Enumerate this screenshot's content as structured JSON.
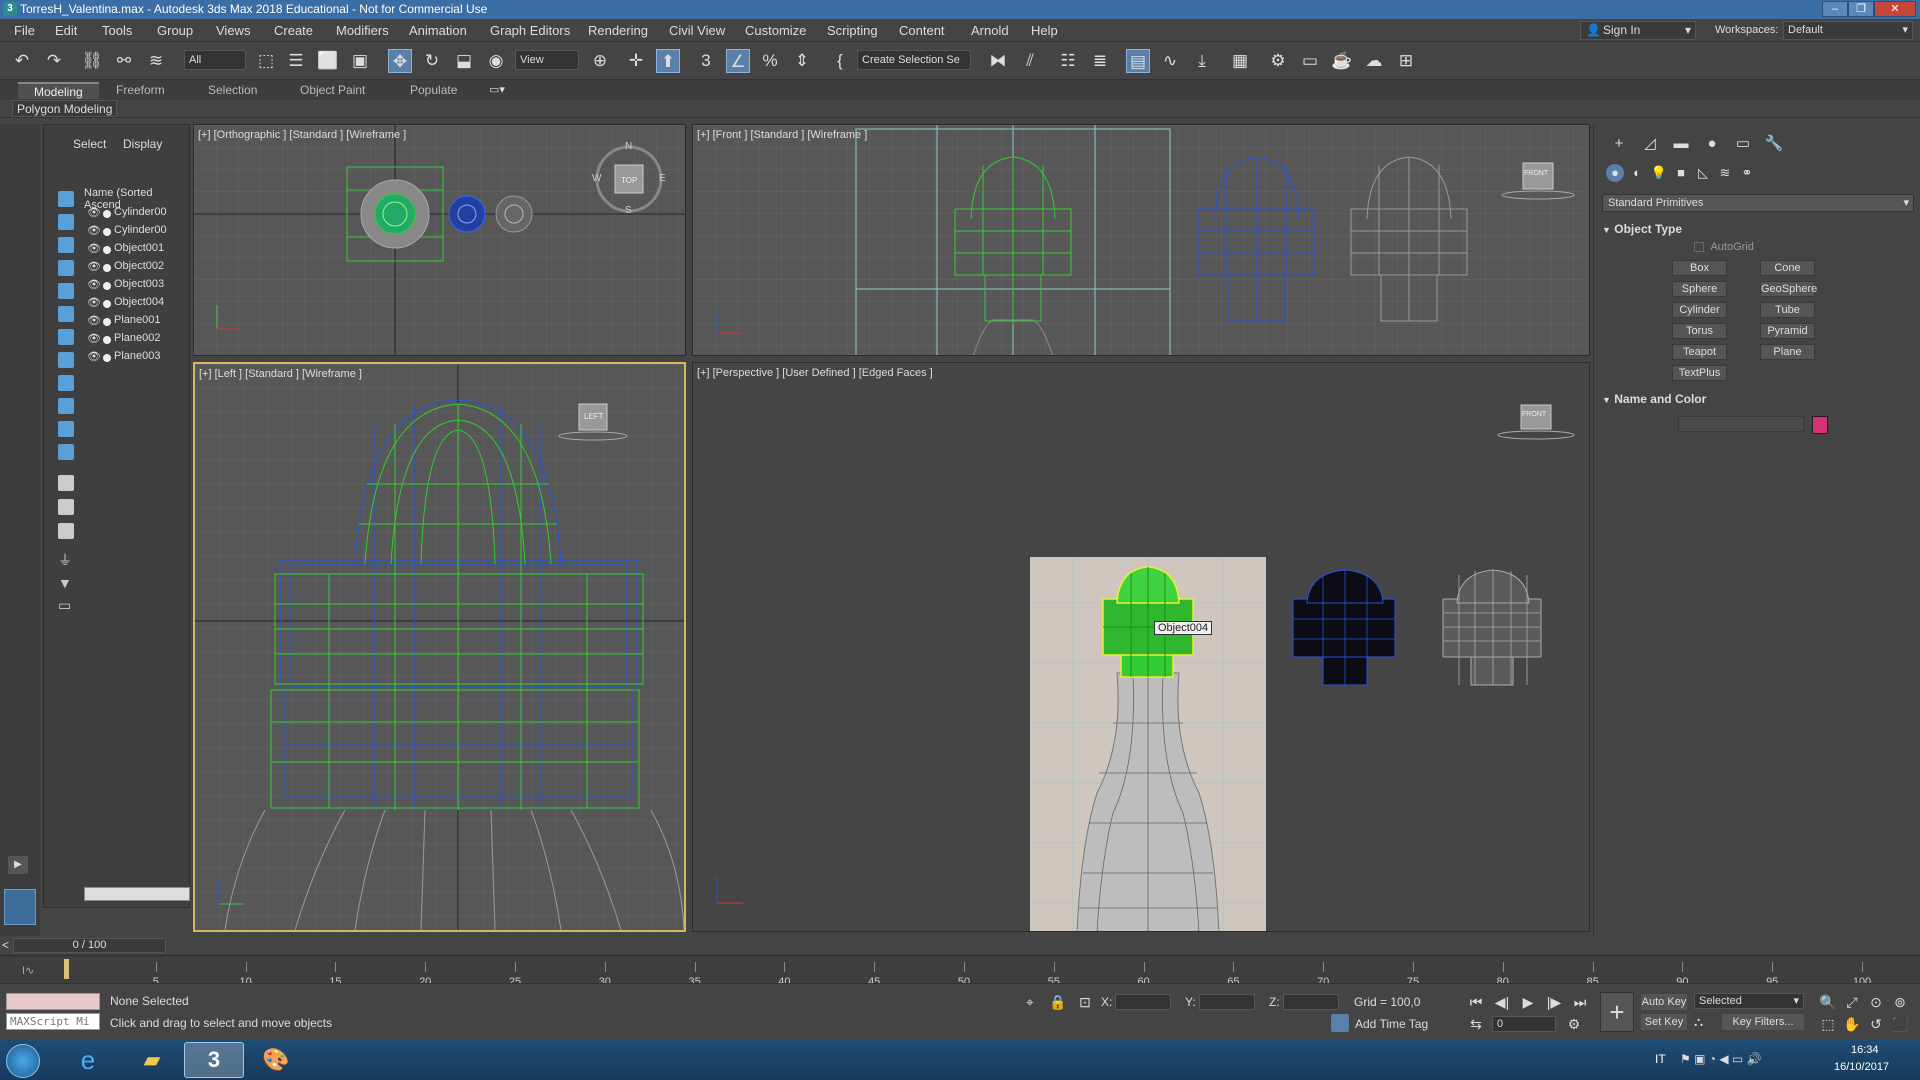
{
  "window": {
    "title": "TorresH_Valentina.max - Autodesk 3ds Max 2018 Educational - Not for Commercial Use"
  },
  "menu": [
    "File",
    "Edit",
    "Tools",
    "Group",
    "Views",
    "Create",
    "Modifiers",
    "Animation",
    "Graph Editors",
    "Rendering",
    "Civil View",
    "Customize",
    "Scripting",
    "Content",
    "Arnold",
    "Help"
  ],
  "account": {
    "sign_in": "Sign In",
    "workspaces_label": "Workspaces:",
    "workspace": "Default"
  },
  "toolbar": {
    "filter": "All",
    "ref_coord": "View",
    "selection_set": "Create Selection Se"
  },
  "ribbon": {
    "tabs": [
      "Modeling",
      "Freeform",
      "Selection",
      "Object Paint",
      "Populate"
    ],
    "active": "Modeling",
    "panel": "Polygon Modeling"
  },
  "explorer": {
    "tabs": [
      "Select",
      "Display"
    ],
    "column_header": "Name (Sorted Ascend",
    "items": [
      "Cylinder00",
      "Cylinder00",
      "Object001",
      "Object002",
      "Object003",
      "Object004",
      "Plane001",
      "Plane002",
      "Plane003"
    ]
  },
  "viewports": {
    "top": {
      "label": "[+] [Orthographic ] [Standard ] [Wireframe ]",
      "cube_label": "TOP",
      "compass": [
        "N",
        "S",
        "E",
        "W"
      ]
    },
    "front": {
      "label": "[+] [Front ] [Standard ] [Wireframe ]",
      "cube_label": "FRONT"
    },
    "left": {
      "label": "[+] [Left ] [Standard ] [Wireframe ]",
      "cube_label": "LEFT"
    },
    "perspective": {
      "label": "[+] [Perspective ] [User Defined ] [Edged Faces ]",
      "tooltip": "Object004",
      "cube_label": "FRONT"
    }
  },
  "command_panel": {
    "category": "Standard Primitives",
    "object_type_header": "Object Type",
    "autogrid": "AutoGrid",
    "primitives": [
      "Box",
      "Cone",
      "Sphere",
      "GeoSphere",
      "Cylinder",
      "Tube",
      "Torus",
      "Pyramid",
      "Teapot",
      "Plane",
      "TextPlus"
    ],
    "name_color_header": "Name and Color",
    "color_swatch": "#d4317a"
  },
  "timeline": {
    "slider": "0 / 100",
    "ticks": [
      "5",
      "10",
      "15",
      "20",
      "25",
      "30",
      "35",
      "40",
      "45",
      "50",
      "55",
      "60",
      "65",
      "70",
      "75",
      "80",
      "85",
      "90",
      "95",
      "100"
    ]
  },
  "status": {
    "selection": "None Selected",
    "prompt": "Click and drag to select and move objects",
    "maxscript": "MAXScript Mi",
    "x_label": "X:",
    "y_label": "Y:",
    "z_label": "Z:",
    "grid": "Grid = 100,0",
    "add_time_tag": "Add Time Tag",
    "auto_key": "Auto Key",
    "set_key": "Set Key",
    "key_mode": "Selected",
    "key_filters": "Key Filters...",
    "frame": "0"
  },
  "taskbar": {
    "lang": "IT",
    "time": "16:34",
    "date": "16/10/2017"
  },
  "colors": {
    "selected_wire": "#33cc33",
    "blue_wire": "#2255dd",
    "gray_wire": "#9a9a9a",
    "active_viewport": "#d7b75a"
  }
}
